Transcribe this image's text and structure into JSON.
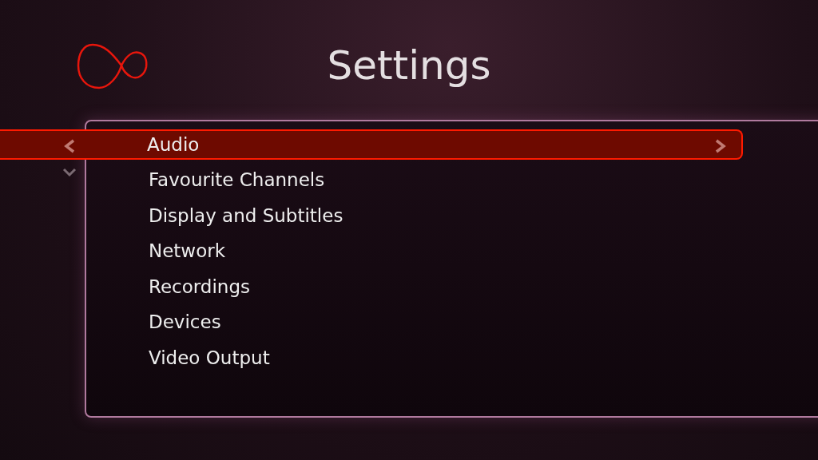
{
  "title": "Settings",
  "menu": [
    {
      "label": "Audio",
      "selected": true
    },
    {
      "label": "Favourite Channels",
      "selected": false
    },
    {
      "label": "Display and Subtitles",
      "selected": false
    },
    {
      "label": "Network",
      "selected": false
    },
    {
      "label": "Recordings",
      "selected": false
    },
    {
      "label": "Devices",
      "selected": false
    },
    {
      "label": "Video Output",
      "selected": false
    }
  ]
}
